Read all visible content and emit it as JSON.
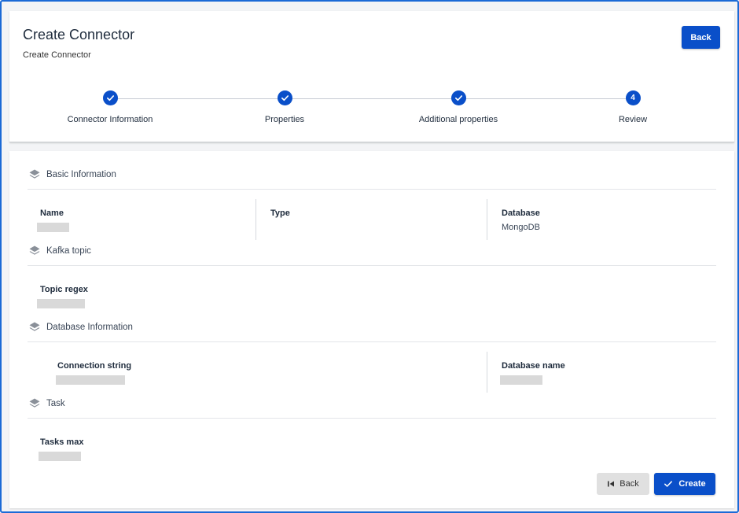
{
  "header": {
    "title": "Create Connector",
    "subtitle": "Create Connector",
    "back_label": "Back"
  },
  "stepper": {
    "steps": [
      {
        "label": "Connector Information",
        "state": "complete",
        "icon": "check-icon"
      },
      {
        "label": "Properties",
        "state": "complete",
        "icon": "check-icon"
      },
      {
        "label": "Additional properties",
        "state": "complete",
        "icon": "check-icon"
      },
      {
        "label": "Review",
        "state": "current",
        "number": "4"
      }
    ]
  },
  "sections": {
    "basic": {
      "title": "Basic Information",
      "icon": "layers-icon",
      "fields": {
        "name": {
          "label": "Name",
          "value": "",
          "redacted": true
        },
        "type": {
          "label": "Type",
          "value": ""
        },
        "database": {
          "label": "Database",
          "value": "MongoDB"
        }
      }
    },
    "kafka": {
      "title": "Kafka topic",
      "icon": "layers-icon",
      "fields": {
        "topic_regex": {
          "label": "Topic regex",
          "value": "",
          "redacted": true
        }
      }
    },
    "database": {
      "title": "Database Information",
      "icon": "layers-icon",
      "fields": {
        "connection_string": {
          "label": "Connection string",
          "value": "",
          "redacted": true
        },
        "database_name": {
          "label": "Database name",
          "value": "",
          "redacted": true
        }
      }
    },
    "task": {
      "title": "Task",
      "icon": "layers-icon",
      "fields": {
        "tasks_max": {
          "label": "Tasks max",
          "value": "",
          "redacted": true
        }
      }
    }
  },
  "footer": {
    "back_label": "Back",
    "back_icon": "skip-previous-icon",
    "create_label": "Create",
    "create_icon": "check-icon"
  },
  "colors": {
    "primary": "#0a4fc9",
    "border": "#1b6ad6",
    "redaction": "#d9d9d9"
  }
}
